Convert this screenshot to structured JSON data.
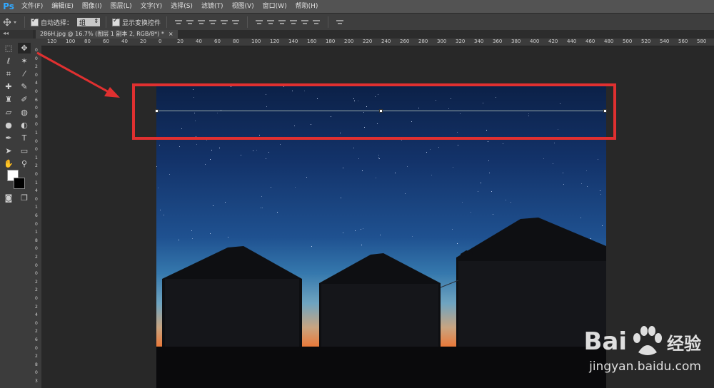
{
  "app": {
    "logo": "Ps"
  },
  "menu": [
    "文件(F)",
    "编辑(E)",
    "图像(I)",
    "图层(L)",
    "文字(Y)",
    "选择(S)",
    "滤镜(T)",
    "视图(V)",
    "窗口(W)",
    "帮助(H)"
  ],
  "options": {
    "auto_select_label": "自动选择：",
    "auto_select_value": "组",
    "show_transform_label": "显示变换控件"
  },
  "document_tab": {
    "title": "286H.jpg @ 16.7% (图层 1 副本 2, RGB/8*) *",
    "close": "×"
  },
  "toolbar": {
    "collapse": "◂◂"
  },
  "ruler_top": [
    "120",
    "100",
    "80",
    "60",
    "40",
    "20",
    "0",
    "20",
    "40",
    "60",
    "80",
    "100",
    "120",
    "140",
    "160",
    "180",
    "200",
    "220",
    "240",
    "260",
    "280",
    "300",
    "320",
    "340",
    "360",
    "380",
    "400",
    "420",
    "440",
    "460",
    "480",
    "500",
    "520",
    "540",
    "560",
    "580"
  ],
  "ruler_left": [
    "0",
    "0",
    "2",
    "0",
    "4",
    "0",
    "6",
    "0",
    "8",
    "0",
    "1",
    "0",
    "0",
    "1",
    "2",
    "0",
    "1",
    "4",
    "0",
    "1",
    "6",
    "0",
    "1",
    "8",
    "0",
    "2",
    "0",
    "0",
    "2",
    "2",
    "0",
    "2",
    "4",
    "0",
    "2",
    "6",
    "0",
    "2",
    "8",
    "0",
    "3"
  ],
  "watermark": {
    "brand": "Bai",
    "brand_cn": "经验",
    "url": "jingyan.baidu.com"
  },
  "colors": {
    "highlight": "#e03030",
    "foreground": "#ffffff",
    "background": "#000000"
  }
}
